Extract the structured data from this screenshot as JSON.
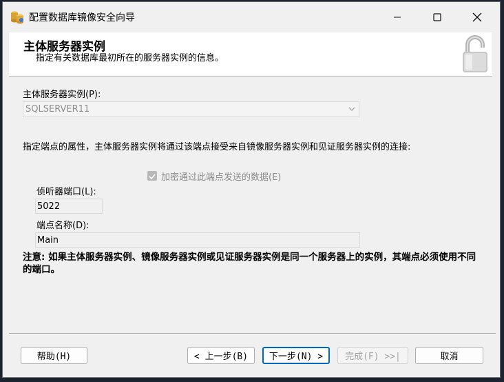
{
  "window": {
    "title": "配置数据库镜像安全向导",
    "minimize_icon": "minimize-icon",
    "maximize_icon": "maximize-icon",
    "close_icon": "close-icon"
  },
  "banner": {
    "title": "主体服务器实例",
    "subtitle": "指定有关数据库最初所在的服务器实例的信息。",
    "icon": "padlock-icon"
  },
  "form": {
    "principal_label": "主体服务器实例(P):",
    "principal_value": "SQLSERVER11",
    "endpoint_instruction": "指定端点的属性，主体服务器实例将通过该端点接受来自镜像服务器实例和见证服务器实例的连接:",
    "encrypt_label": "加密通过此端点发送的数据(E)",
    "encrypt_checked": true,
    "listener_port_label": "侦听器端口(L):",
    "listener_port_value": "5022",
    "endpoint_name_label": "端点名称(D):",
    "endpoint_name_value": "Main",
    "note": "注意: 如果主体服务器实例、镜像服务器实例或见证服务器实例是同一个服务器上的实例，其端点必须使用不同的端口。"
  },
  "buttons": {
    "help": "帮助(H)",
    "back": "< 上一步(B)",
    "next": "下一步(N) >",
    "finish": "完成(F) >>|",
    "cancel": "取消"
  },
  "colors": {
    "accent": "#0067c0",
    "disabled_text": "#a3a3a3"
  }
}
